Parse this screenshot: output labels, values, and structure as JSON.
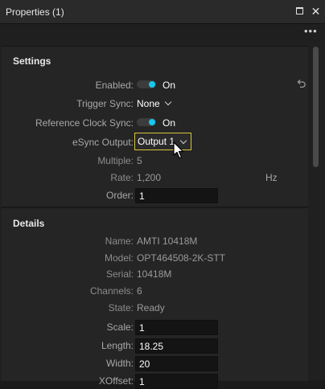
{
  "window": {
    "title": "Properties (1)"
  },
  "settings": {
    "heading": "Settings",
    "enabled": {
      "label": "Enabled:",
      "value": "On"
    },
    "trigger_sync": {
      "label": "Trigger Sync:",
      "value": "None"
    },
    "reference_clock_sync": {
      "label": "Reference Clock Sync:",
      "value": "On"
    },
    "esync_output": {
      "label": "eSync Output:",
      "value": "Output 1"
    },
    "multiple": {
      "label": "Multiple:",
      "value": "5"
    },
    "rate": {
      "label": "Rate:",
      "value": "1,200",
      "unit": "Hz"
    },
    "order": {
      "label": "Order:",
      "value": "1"
    }
  },
  "details": {
    "heading": "Details",
    "name": {
      "label": "Name:",
      "value": "AMTI 10418M"
    },
    "model": {
      "label": "Model:",
      "value": "OPT464508-2K-STT"
    },
    "serial": {
      "label": "Serial:",
      "value": "10418M"
    },
    "channels": {
      "label": "Channels:",
      "value": "6"
    },
    "state": {
      "label": "State:",
      "value": "Ready"
    },
    "scale": {
      "label": "Scale:",
      "value": "1"
    },
    "length": {
      "label": "Length:",
      "value": "18.25"
    },
    "width": {
      "label": "Width:",
      "value": "20"
    },
    "xoffset": {
      "label": "XOffset:",
      "value": "1"
    }
  },
  "colors": {
    "accent_toggle": "#16c8f0",
    "focus_border": "#d6c53a"
  },
  "icons": [
    "maximize-icon",
    "close-icon",
    "more-icon",
    "reset-icon",
    "chevron-down-icon",
    "cursor-icon"
  ]
}
